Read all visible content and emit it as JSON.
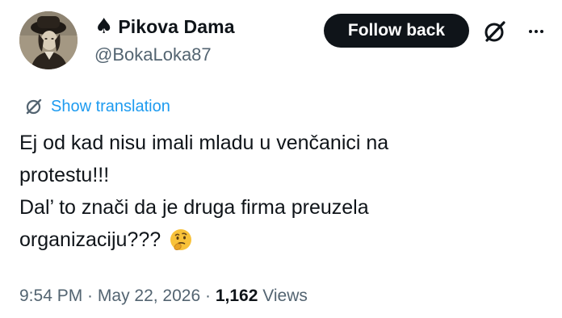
{
  "author": {
    "display_name": "Pikova Dama",
    "name_icon": "♠",
    "handle": "@BokaLoka87"
  },
  "actions": {
    "follow_label": "Follow back",
    "grok_icon": "grok-slash-circle-icon",
    "more_icon": "more-horizontal-icon"
  },
  "translation": {
    "label": "Show translation",
    "icon": "grok-slash-circle-icon"
  },
  "tweet": {
    "line1": "Ej od kad nisu imali mladu u venčanici na",
    "line2": "protestu!!!",
    "line3": "Dal’ to znači da je druga firma preuzela",
    "line4": "organizaciju???",
    "emoji": "thinking-face-emoji"
  },
  "meta": {
    "time": "9:54 PM",
    "sep1": " · ",
    "date": "May 22, 2026",
    "sep2": " · ",
    "views_count": "1,162",
    "views_label": " Views"
  },
  "colors": {
    "text": "#0f1419",
    "secondary": "#536471",
    "link": "#1d9bf0",
    "button_bg": "#0f1419",
    "button_text": "#ffffff"
  }
}
